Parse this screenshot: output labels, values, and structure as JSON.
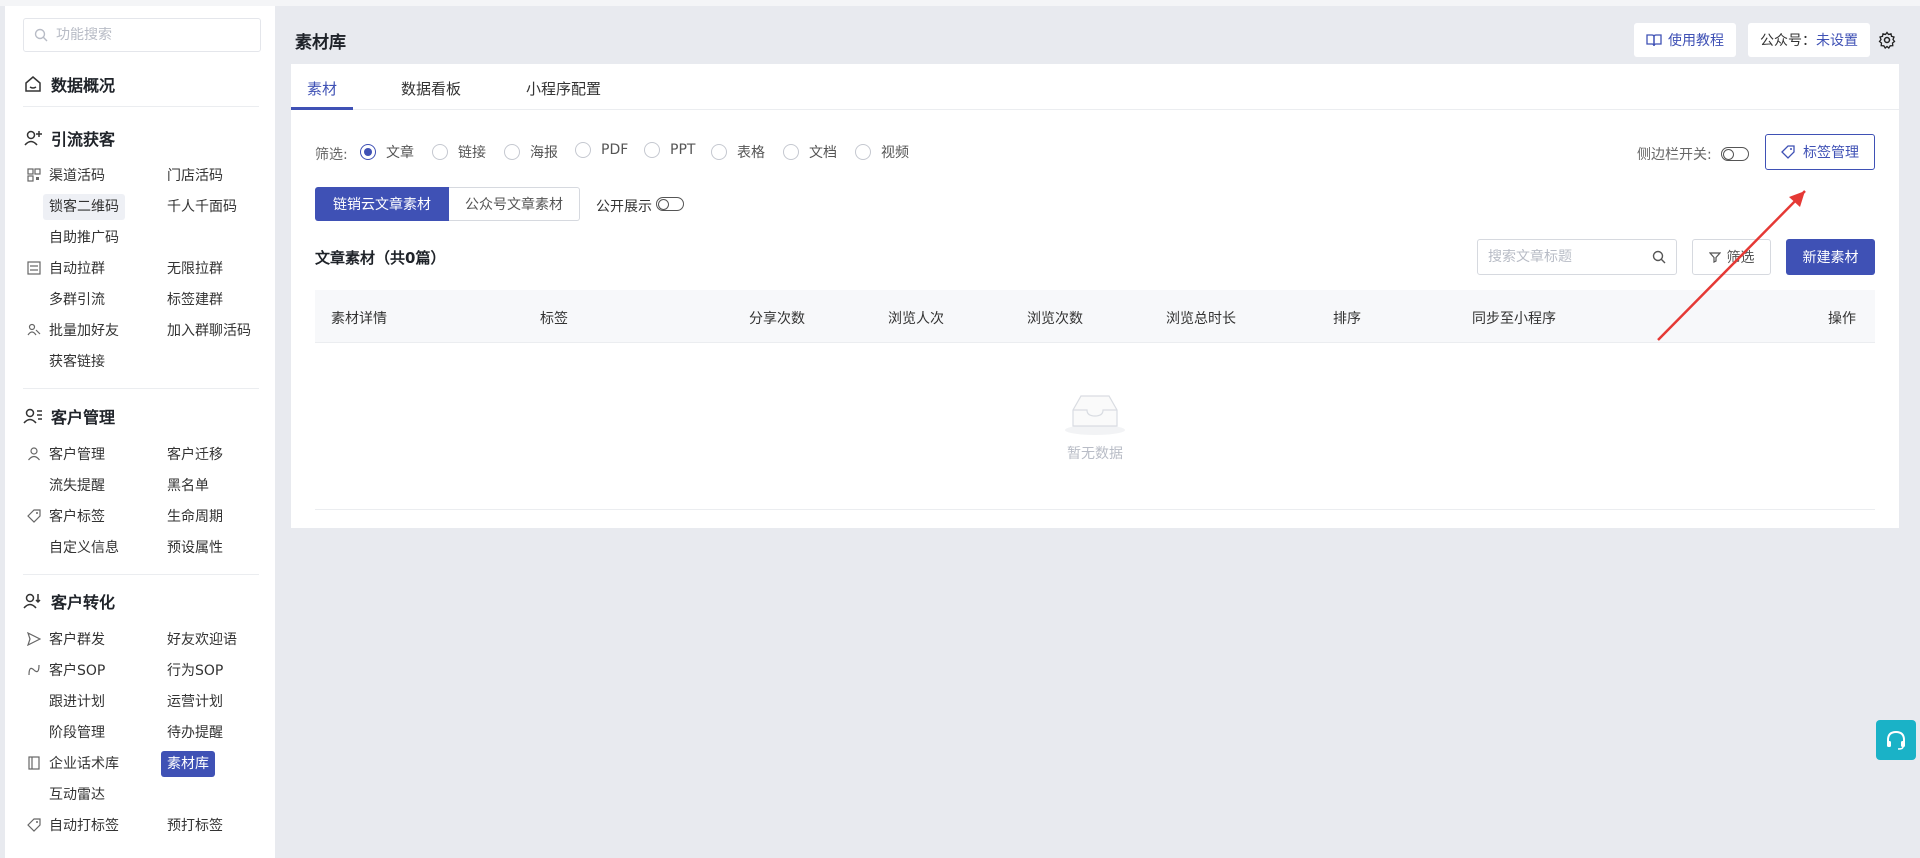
{
  "search": {
    "placeholder": "功能搜索"
  },
  "sidebar": {
    "overview": "数据概况",
    "sections": {
      "traffic": "引流获客",
      "customer": "客户管理",
      "conversion": "客户转化"
    },
    "items": {
      "channel_code": "渠道活码",
      "store_code": "门店活码",
      "lock_qr": "锁客二维码",
      "personal_code": "千人千面码",
      "self_promo": "自助推广码",
      "auto_group": "自动拉群",
      "unlimited_group": "无限拉群",
      "multi_group": "多群引流",
      "tag_group": "标签建群",
      "batch_add": "批量加好友",
      "join_group_code": "加入群聊活码",
      "acquire_link": "获客链接",
      "customer_mgmt": "客户管理",
      "customer_migrate": "客户迁移",
      "churn_alert": "流失提醒",
      "blacklist": "黑名单",
      "customer_tag": "客户标签",
      "lifecycle": "生命周期",
      "custom_info": "自定义信息",
      "preset_attr": "预设属性",
      "mass_send": "客户群发",
      "welcome": "好友欢迎语",
      "customer_sop": "客户SOP",
      "behavior_sop": "行为SOP",
      "follow_plan": "跟进计划",
      "ops_plan": "运营计划",
      "stage_mgmt": "阶段管理",
      "todo_alert": "待办提醒",
      "script_lib": "企业话术库",
      "material_lib": "素材库",
      "radar": "互动雷达",
      "auto_tag": "自动打标签",
      "pre_tag": "预打标签"
    }
  },
  "header": {
    "title": "素材库",
    "tutorial": "使用教程",
    "account_label": "公众号：",
    "account_value": "未设置"
  },
  "tabs": [
    "素材",
    "数据看板",
    "小程序配置"
  ],
  "filter": {
    "label": "筛选:",
    "options": [
      "文章",
      "链接",
      "海报",
      "PDF",
      "PPT",
      "表格",
      "文档",
      "视频"
    ],
    "selected": "文章",
    "sidebar_switch_label": "侧边栏开关:",
    "tag_manage": "标签管理"
  },
  "segments": [
    "链销云文章素材",
    "公众号文章素材"
  ],
  "public_label": "公开展示",
  "list": {
    "title": "文章素材（共0篇）",
    "search_placeholder": "搜索文章标题",
    "filter_btn": "筛选",
    "new_btn": "新建素材"
  },
  "table": {
    "columns": [
      "素材详情",
      "标签",
      "分享次数",
      "浏览人次",
      "浏览次数",
      "浏览总时长",
      "排序",
      "同步至小程序",
      "操作"
    ],
    "empty_text": "暂无数据"
  },
  "colors": {
    "accent": "#3f51b5",
    "annotation": "#e53935",
    "support": "#1ab2c7"
  }
}
